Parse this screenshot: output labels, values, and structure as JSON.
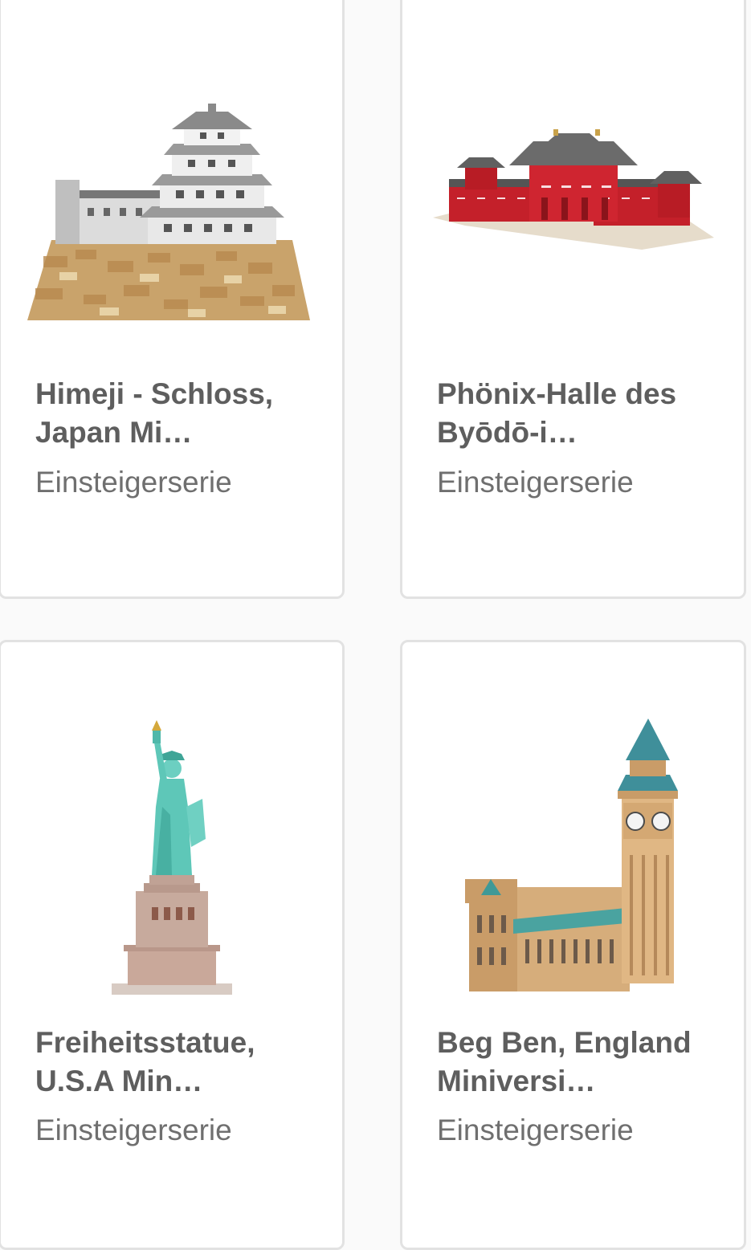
{
  "products": [
    {
      "title_line1": "Himeji - Schloss,",
      "title_line2": "Japan Mi…",
      "series": "Einsteigerserie",
      "image_icon": "himeji-castle-model"
    },
    {
      "title_line1": "Phönix-Halle des",
      "title_line2": "Byōdō-i…",
      "series": "Einsteigerserie",
      "image_icon": "phoenix-hall-model"
    },
    {
      "title_line1": "Freiheitsstatue,",
      "title_line2": "U.S.A Min…",
      "series": "Einsteigerserie",
      "image_icon": "statue-of-liberty-model"
    },
    {
      "title_line1": "Beg Ben, England",
      "title_line2": "Miniversi…",
      "series": "Einsteigerserie",
      "image_icon": "big-ben-model"
    }
  ],
  "colors": {
    "card_border": "#e2e2e2",
    "title_text": "#5e5e5e",
    "subtitle_text": "#6f6f6f",
    "page_background": "#fafafa"
  }
}
